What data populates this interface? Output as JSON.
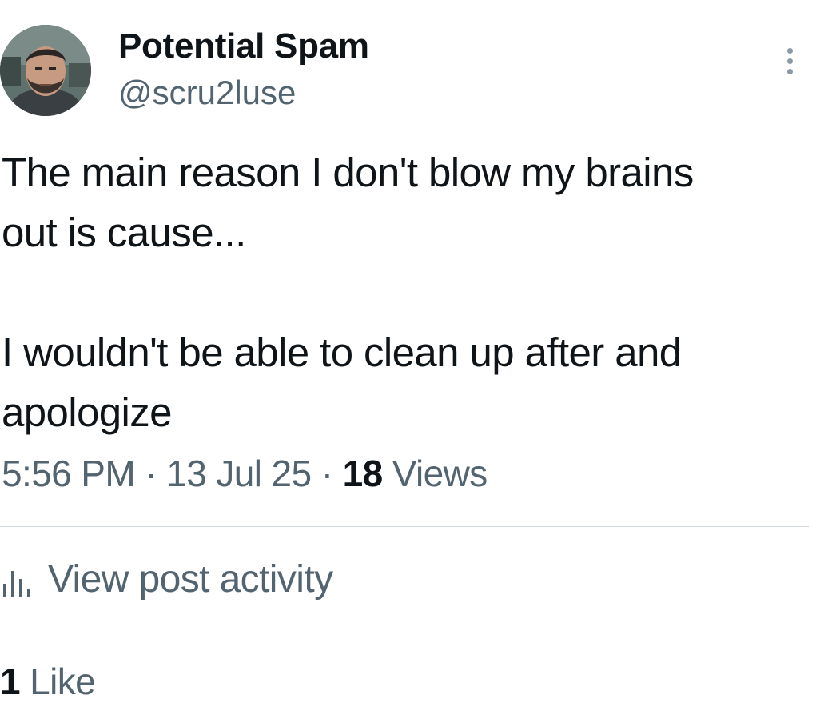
{
  "author": {
    "display_name": "Potential Spam",
    "handle": "@scru2luse",
    "avatar_icon": "avatar-photo"
  },
  "more_icon": "more-vertical-icon",
  "tweet": {
    "paragraph_1": "The main reason I don't blow my brains\nout is cause...",
    "paragraph_2": "I wouldn't be able to clean up after and\napologize"
  },
  "meta": {
    "time": "5:56 PM",
    "separator": " · ",
    "date": "13 Jul 25",
    "views_count": "18",
    "views_label": "Views"
  },
  "activity": {
    "icon": "analytics-bars-icon",
    "label": "View post activity"
  },
  "likes": {
    "count": "1",
    "label": "Like"
  },
  "colors": {
    "text_primary": "#0f1419",
    "text_secondary": "#536471",
    "divider": "#cfd9de"
  }
}
